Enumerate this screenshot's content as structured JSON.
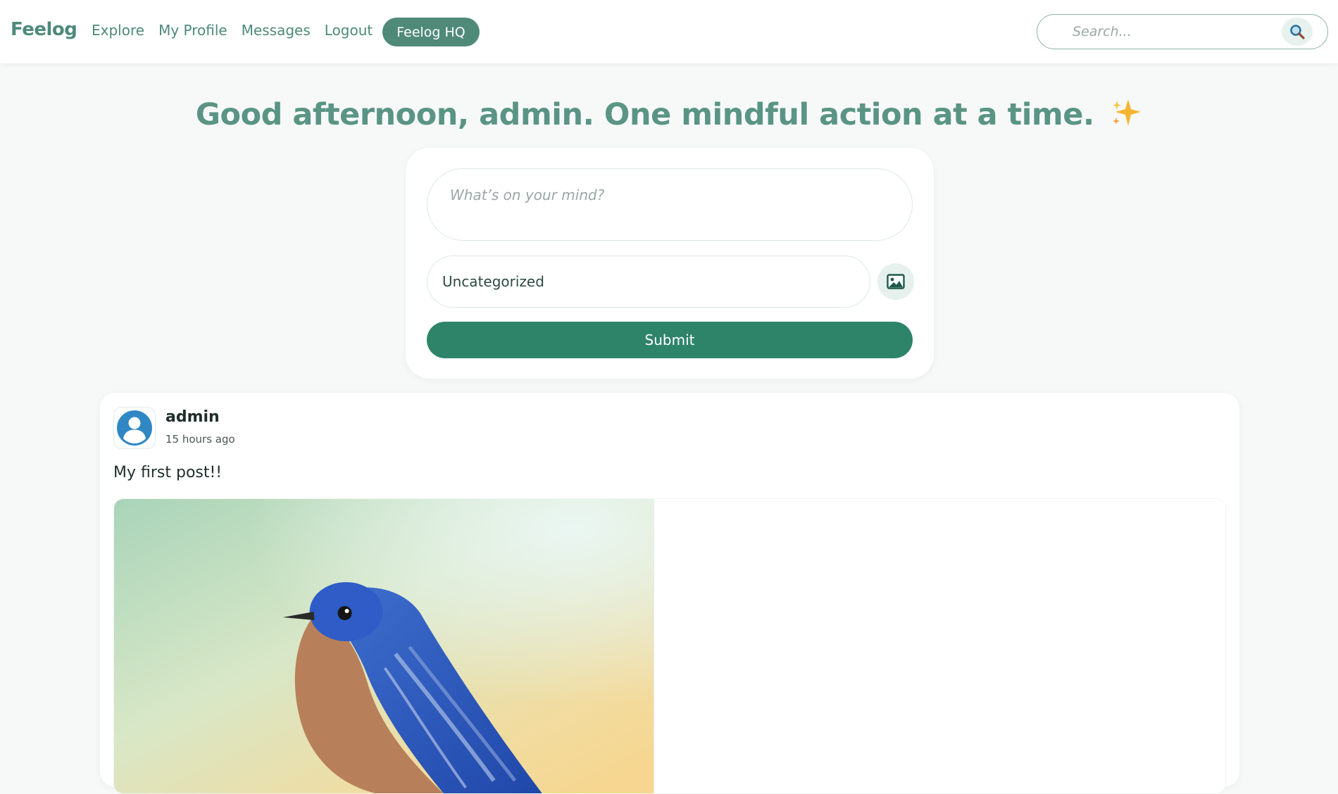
{
  "brand": {
    "name": "Feelog",
    "color": "#4d8a78"
  },
  "nav": {
    "links": [
      {
        "label": "Explore"
      },
      {
        "label": "My Profile"
      },
      {
        "label": "Messages"
      },
      {
        "label": "Logout"
      }
    ],
    "hq_button": "Feelog HQ"
  },
  "search": {
    "placeholder": "Search...",
    "icon": "magnifier-icon"
  },
  "greeting": {
    "text": "Good afternoon, admin. One mindful action at a time.",
    "emoji": "✨"
  },
  "composer": {
    "placeholder": "What’s on your mind?",
    "category": "Uncategorized",
    "image_icon": "image-upload-icon",
    "submit_label": "Submit",
    "accent": "#2e8468"
  },
  "post": {
    "author": "admin",
    "time": "15 hours ago",
    "text": "My first post!!",
    "avatar_icon": "user-avatar-icon",
    "image_subject": "bluebird-photo"
  }
}
